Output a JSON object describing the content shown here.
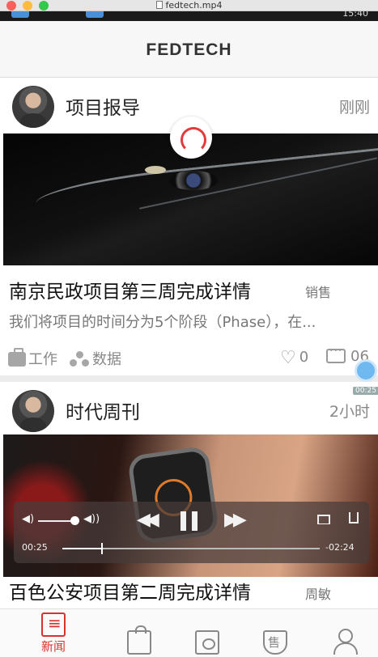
{
  "window": {
    "title": "fedtech.mp4"
  },
  "status": {
    "time": "15:40"
  },
  "header": {
    "title": "FEDTECH"
  },
  "feed": [
    {
      "source": "项目报导",
      "time": "刚刚",
      "title": "南京民政项目第三周完成详情",
      "tag": "销售",
      "summary": "我们将项目的时间分为5个阶段（Phase），在...",
      "category_work": "工作",
      "category_data": "数据",
      "likes": "0",
      "comments": "06"
    },
    {
      "source": "时代周刊",
      "time": "2小时",
      "title": "百色公安项目第二周完成详情",
      "tag": "周敏"
    }
  ],
  "player": {
    "elapsed": "00:25",
    "remaining": "-02:24",
    "progress": 0.15,
    "volume": 0.8,
    "side_badge_time": "00:25"
  },
  "tabbar": {
    "items": [
      {
        "label": "新闻",
        "icon": "news-icon",
        "active": true
      },
      {
        "label": "",
        "icon": "shopping-bag-icon",
        "active": false
      },
      {
        "label": "",
        "icon": "eye-icon",
        "active": false
      },
      {
        "label": "",
        "icon": "sale-shield-icon",
        "active": false
      },
      {
        "label": "",
        "icon": "user-icon",
        "active": false
      }
    ]
  },
  "colors": {
    "accent": "#d9322e",
    "loader": "#e23b3b",
    "player_badge": "#6fb8f0"
  }
}
